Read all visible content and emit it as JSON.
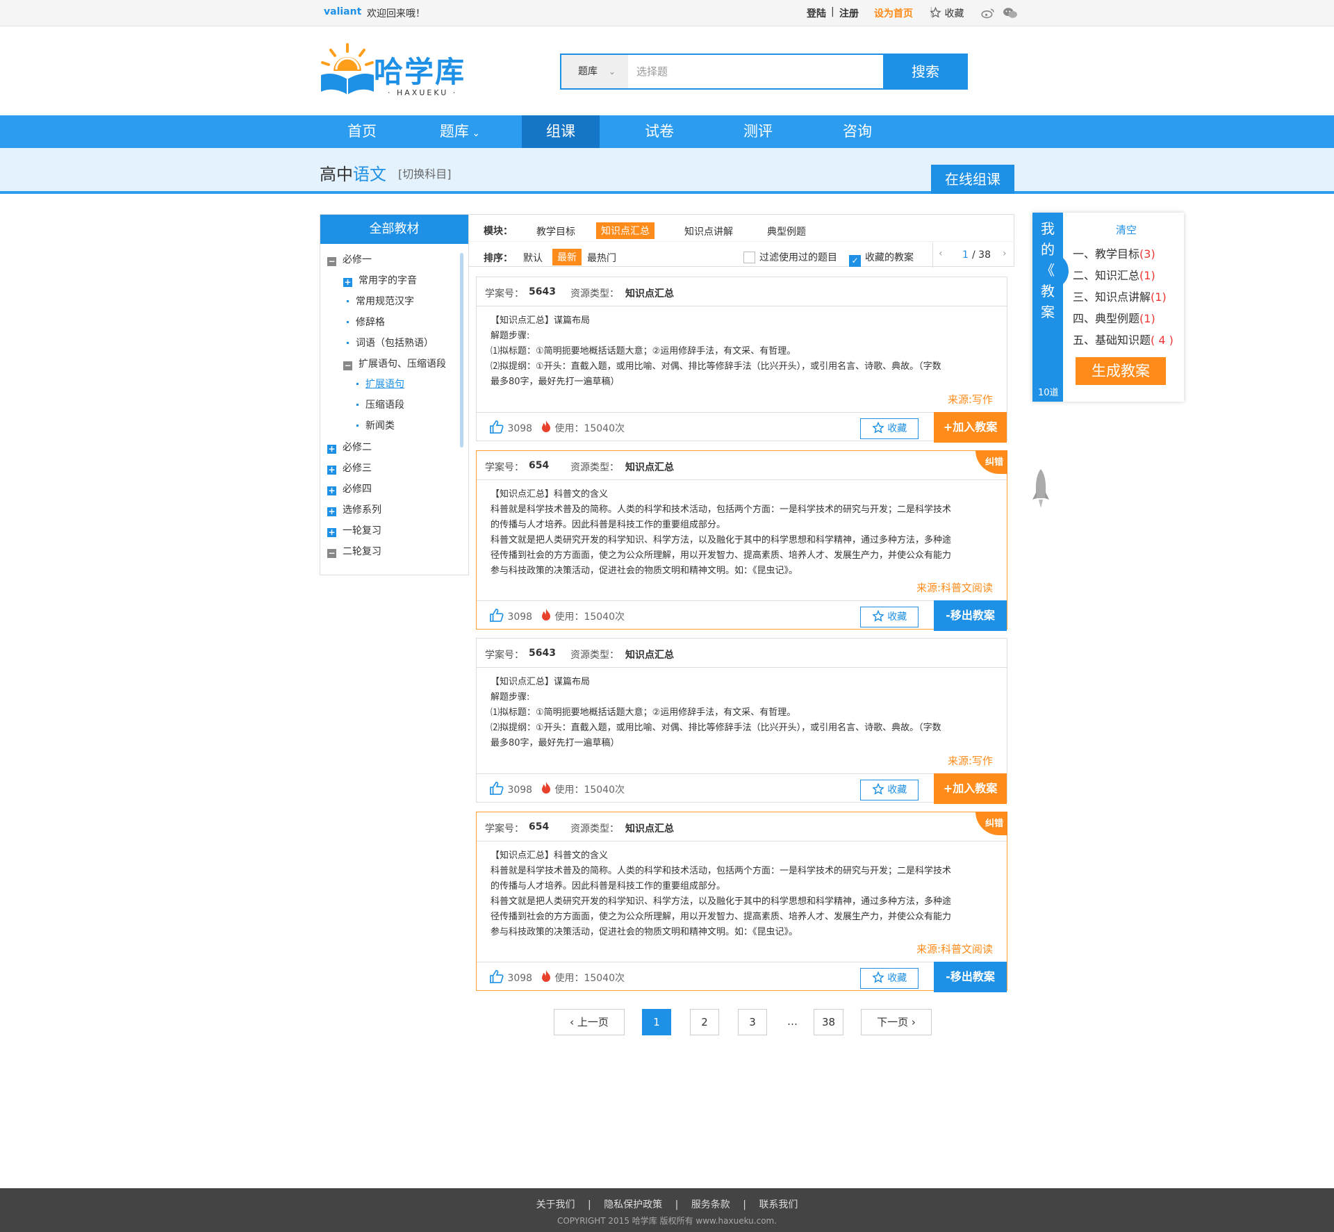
{
  "topbar": {
    "username": "valiant",
    "welcome": "欢迎回来哦！",
    "login": "登陆",
    "register": "注册",
    "sethome": "设为首页",
    "favorite": "收藏"
  },
  "logo": {
    "name": "哈学库",
    "sub": "· HAXUEKU ·"
  },
  "search": {
    "category": "题库",
    "placeholder": "选择题",
    "button": "搜索"
  },
  "nav": [
    {
      "label": "首页"
    },
    {
      "label": "题库"
    },
    {
      "label": "组课"
    },
    {
      "label": "试卷"
    },
    {
      "label": "测评"
    },
    {
      "label": "咨询"
    }
  ],
  "subject": {
    "level": "高中",
    "name": "语文",
    "switch": "[切换科目]",
    "online_button": "在线组课"
  },
  "sidebar": {
    "title": "全部教材",
    "items": [
      {
        "label": "必修一"
      },
      {
        "label": "常用字的字音"
      },
      {
        "label": "常用规范汉字"
      },
      {
        "label": "修辞格"
      },
      {
        "label": "词语（包括熟语）"
      },
      {
        "label": "扩展语句、压缩语段"
      },
      {
        "label": "扩展语句"
      },
      {
        "label": "压缩语段"
      },
      {
        "label": "新闻类"
      },
      {
        "label": "必修二"
      },
      {
        "label": "必修三"
      },
      {
        "label": "必修四"
      },
      {
        "label": "选修系列"
      },
      {
        "label": "一轮复习"
      },
      {
        "label": "二轮复习"
      }
    ]
  },
  "filters": {
    "module_label": "模块：",
    "modules": [
      "教学目标",
      "知识点汇总",
      "知识点讲解",
      "典型例题"
    ],
    "sort_label": "排序：",
    "sorts": [
      "默认",
      "最新",
      "最热门"
    ],
    "filter_used": "过滤使用过的题目",
    "favorited": "收藏的教案",
    "page_current": "1",
    "page_total": "/ 38"
  },
  "cards": [
    {
      "id_label": "学案号：",
      "id": "5643",
      "type_label": "资源类型：",
      "type": "知识点汇总",
      "lines": [
        "【知识点汇总】谋篇布局",
        "解题步骤:",
        "⑴拟标题：①简明扼要地概括话题大意；②运用修辞手法，有文采、有哲理。",
        "⑵拟提纲：①开头：直截入题，或用比喻、对偶、排比等修辞手法（比兴开头），或引用名言、诗歌、典故。（字数",
        "最多80字，最好先打一遍草稿）"
      ],
      "source": "来源:写作",
      "likes": "3098",
      "uses": "使用：15040次",
      "fav": "收藏",
      "action": "+加入教案"
    },
    {
      "id_label": "学案号：",
      "id": "654",
      "type_label": "资源类型：",
      "type": "知识点汇总",
      "corner": "纠错",
      "lines": [
        "【知识点汇总】科普文的含义",
        "科普就是科学技术普及的简称。人类的科学和技术活动，包括两个方面：一是科学技术的研究与开发；二是科学技术",
        "的传播与人才培养。因此科普是科技工作的重要组成部分。",
        "科普文就是把人类研究开发的科学知识、科学方法，以及融化于其中的科学思想和科学精神，通过多种方法，多种途",
        "径传播到社会的方方面面，使之为公众所理解，用以开发智力、提高素质、培养人才、发展生产力，并使公众有能力",
        "参与科技政策的决策活动，促进社会的物质文明和精神文明。如：《昆虫记》。"
      ],
      "source": "来源:科普文阅读",
      "likes": "3098",
      "uses": "使用：15040次",
      "fav": "收藏",
      "action": "-移出教案"
    },
    {
      "id_label": "学案号：",
      "id": "5643",
      "type_label": "资源类型：",
      "type": "知识点汇总",
      "lines": [
        "【知识点汇总】谋篇布局",
        "解题步骤:",
        "⑴拟标题：①简明扼要地概括话题大意；②运用修辞手法，有文采、有哲理。",
        "⑵拟提纲：①开头：直截入题，或用比喻、对偶、排比等修辞手法（比兴开头），或引用名言、诗歌、典故。（字数",
        "最多80字，最好先打一遍草稿）"
      ],
      "source": "来源:写作",
      "likes": "3098",
      "uses": "使用：15040次",
      "fav": "收藏",
      "action": "+加入教案"
    },
    {
      "id_label": "学案号：",
      "id": "654",
      "type_label": "资源类型：",
      "type": "知识点汇总",
      "corner": "纠错",
      "lines": [
        "【知识点汇总】科普文的含义",
        "科普就是科学技术普及的简称。人类的科学和技术活动，包括两个方面：一是科学技术的研究与开发；二是科学技术",
        "的传播与人才培养。因此科普是科技工作的重要组成部分。",
        "科普文就是把人类研究开发的科学知识、科学方法，以及融化于其中的科学思想和科学精神，通过多种方法，多种途",
        "径传播到社会的方方面面，使之为公众所理解，用以开发智力、提高素质、培养人才、发展生产力，并使公众有能力",
        "参与科技政策的决策活动，促进社会的物质文明和精神文明。如：《昆虫记》。"
      ],
      "source": "来源:科普文阅读",
      "likes": "3098",
      "uses": "使用：15040次",
      "fav": "收藏",
      "action": "-移出教案"
    }
  ],
  "pagination": {
    "prev": "上一页",
    "pages": [
      "1",
      "2",
      "3",
      "…",
      "38"
    ],
    "next": "下一页"
  },
  "plan": {
    "title_chars": [
      "我",
      "的",
      "《",
      "教",
      "案"
    ],
    "count": "10道",
    "clear": "清空",
    "items": [
      {
        "label": "一、教学目标",
        "count": "(3)"
      },
      {
        "label": "二、知识汇总",
        "count": "(1)"
      },
      {
        "label": "三、知识点讲解",
        "count": "(1)"
      },
      {
        "label": "四、典型例题",
        "count": "(1)"
      },
      {
        "label": "五、基础知识题",
        "count": "( 4 )"
      }
    ],
    "generate": "生成教案"
  },
  "footer": {
    "links": [
      "关于我们",
      "隐私保护政策",
      "服务条款",
      "联系我们"
    ],
    "copyright": "COPYRIGHT 2015   哈学库  版权所有   www.haxueku.com."
  },
  "colors": {
    "primary": "#1e90e6",
    "accent": "#ff8c1a",
    "nav": "#2b9cf0",
    "nav_active": "#1576c7"
  }
}
